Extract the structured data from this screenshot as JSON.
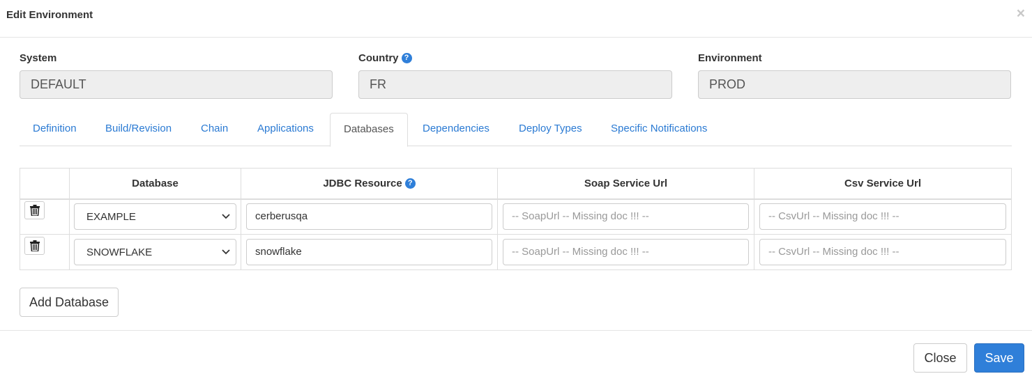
{
  "modal": {
    "title": "Edit Environment",
    "close_icon": "×"
  },
  "fields": {
    "system": {
      "label": "System",
      "value": "DEFAULT"
    },
    "country": {
      "label": "Country",
      "value": "FR",
      "help": "?"
    },
    "environment": {
      "label": "Environment",
      "value": "PROD"
    }
  },
  "tabs": [
    "Definition",
    "Build/Revision",
    "Chain",
    "Applications",
    "Databases",
    "Dependencies",
    "Deploy Types",
    "Specific Notifications"
  ],
  "active_tab": "Databases",
  "table": {
    "headers": {
      "database": "Database",
      "jdbc": "JDBC Resource",
      "jdbc_help": "?",
      "soap": "Soap Service Url",
      "csv": "Csv Service Url"
    },
    "rows": [
      {
        "database": "EXAMPLE",
        "jdbc": "cerberusqa",
        "soap_placeholder": "-- SoapUrl -- Missing doc !!! --",
        "csv_placeholder": "-- CsvUrl -- Missing doc !!! --"
      },
      {
        "database": "SNOWFLAKE",
        "jdbc": "snowflake",
        "soap_placeholder": "-- SoapUrl -- Missing doc !!! --",
        "csv_placeholder": "-- CsvUrl -- Missing doc !!! --"
      }
    ]
  },
  "buttons": {
    "add_database": "Add Database",
    "close": "Close",
    "save": "Save"
  },
  "colors": {
    "primary": "#2f7fd9",
    "link": "#2a7ad3"
  }
}
